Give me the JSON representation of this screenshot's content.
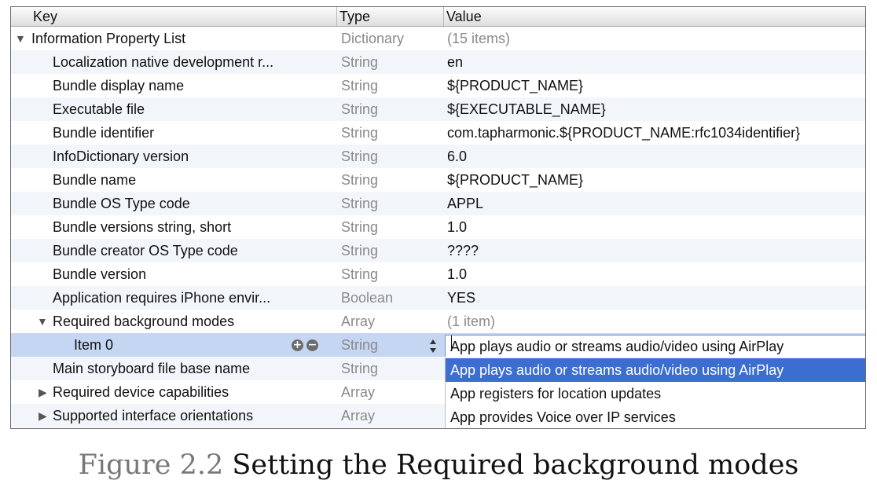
{
  "header": {
    "key": "Key",
    "type": "Type",
    "value": "Value"
  },
  "rows": [
    {
      "key": "Information Property List",
      "type": "Dictionary",
      "value": "(15 items)"
    },
    {
      "key": "Localization native development r...",
      "type": "String",
      "value": "en"
    },
    {
      "key": "Bundle display name",
      "type": "String",
      "value": "${PRODUCT_NAME}"
    },
    {
      "key": "Executable file",
      "type": "String",
      "value": "${EXECUTABLE_NAME}"
    },
    {
      "key": "Bundle identifier",
      "type": "String",
      "value": "com.tapharmonic.${PRODUCT_NAME:rfc1034identifier}"
    },
    {
      "key": "InfoDictionary version",
      "type": "String",
      "value": "6.0"
    },
    {
      "key": "Bundle name",
      "type": "String",
      "value": "${PRODUCT_NAME}"
    },
    {
      "key": "Bundle OS Type code",
      "type": "String",
      "value": "APPL"
    },
    {
      "key": "Bundle versions string, short",
      "type": "String",
      "value": "1.0"
    },
    {
      "key": "Bundle creator OS Type code",
      "type": "String",
      "value": "????"
    },
    {
      "key": "Bundle version",
      "type": "String",
      "value": "1.0"
    },
    {
      "key": "Application requires iPhone envir...",
      "type": "Boolean",
      "value": "YES"
    },
    {
      "key": "Required background modes",
      "type": "Array",
      "value": "(1 item)"
    },
    {
      "key": "Item 0",
      "type": "String",
      "value": "App plays audio or streams audio/video using AirPlay"
    },
    {
      "key": "Main storyboard file base name",
      "type": "String",
      "value": ""
    },
    {
      "key": "Required device capabilities",
      "type": "Array",
      "value": ""
    },
    {
      "key": "Supported interface orientations",
      "type": "Array",
      "value": ""
    }
  ],
  "dropdown": {
    "options": [
      "App plays audio or streams audio/video using AirPlay",
      "App registers for location updates",
      "App provides Voice over IP services"
    ],
    "selected": "App plays audio or streams audio/video using AirPlay"
  },
  "caption": {
    "figure_number": "Figure 2.2",
    "text": "Setting the Required background modes"
  },
  "icons": {
    "add": "plus-circle-icon",
    "remove": "minus-circle-icon",
    "stepper": "up-down-stepper-icon"
  },
  "colors": {
    "selection_row": "#c4d6f2",
    "dropdown_highlight": "#3c6ed2",
    "type_text": "#8a8a8a"
  }
}
